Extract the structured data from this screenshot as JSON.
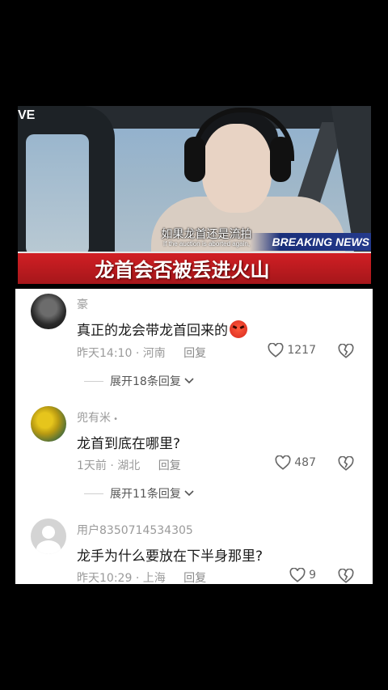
{
  "video": {
    "live_tag": "VE",
    "subtitle_cn": "如果龙首还是流拍",
    "subtitle_en": "If the auction is aborted again,",
    "breaking": "BREAKING NEWS",
    "banner_title": "龙首会否被丢进火山"
  },
  "comments": [
    {
      "username": "豪",
      "text": "真正的龙会带龙首回来的",
      "emoji": "angry-face",
      "time": "昨天14:10",
      "location": "河南",
      "reply_label": "回复",
      "likes": "1217",
      "expand_label": "展开18条回复"
    },
    {
      "username": "兜有米",
      "text": "龙首到底在哪里?",
      "time": "1天前",
      "location": "湖北",
      "reply_label": "回复",
      "likes": "487",
      "expand_label": "展开11条回复"
    },
    {
      "username": "用户8350714534305",
      "text": "龙手为什么要放在下半身那里?",
      "time": "昨天10:29",
      "location": "上海",
      "reply_label": "回复",
      "likes": "9"
    }
  ],
  "colors": {
    "background": "#000000",
    "panel": "#ffffff",
    "banner_red": "#d11f24",
    "meta_gray": "#9a9a9a"
  }
}
